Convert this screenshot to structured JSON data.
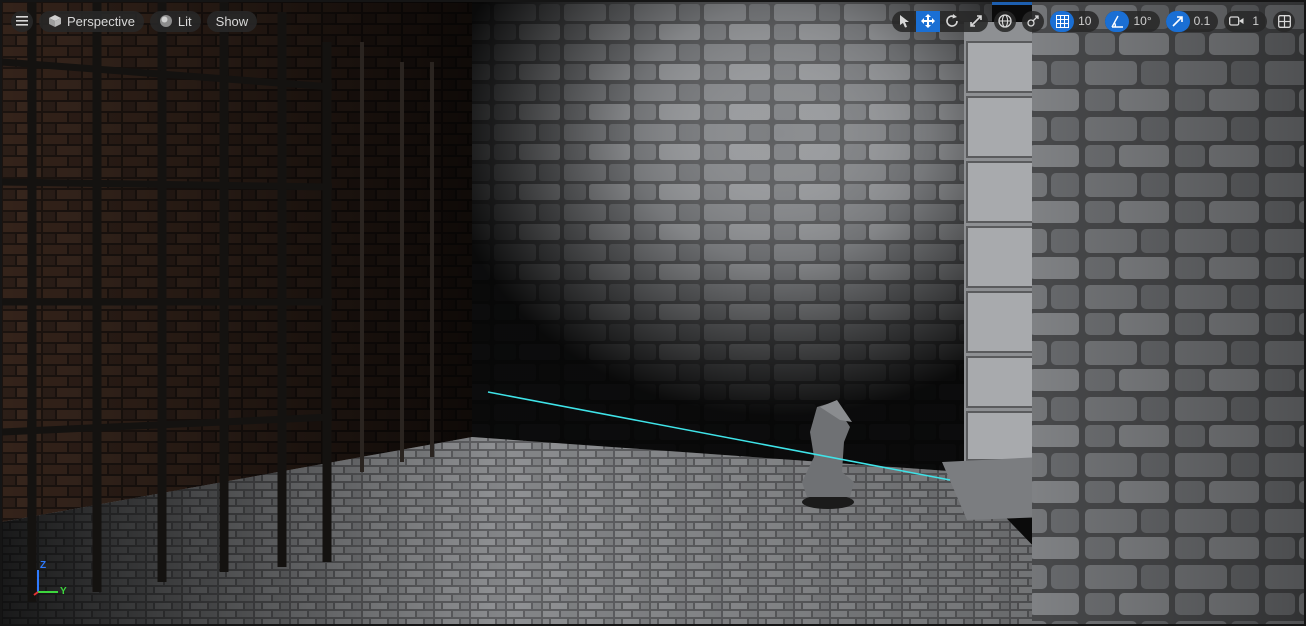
{
  "viewport": {
    "view_mode": "Perspective",
    "lighting_mode": "Lit",
    "show_label": "Show",
    "grid_snap_value": "10",
    "rotation_snap_value": "10°",
    "scale_snap_value": "0.1",
    "camera_speed": "1",
    "axis_labels": {
      "z": "Z",
      "y": "Y"
    }
  },
  "colors": {
    "accent": "#1a6fd4",
    "toolbar_bg": "#282828",
    "trace_line": "#3fe3e8"
  },
  "icons": {
    "menu": "hamburger-icon",
    "perspective": "cube-icon",
    "lit": "sphere-icon",
    "select": "pointer-icon",
    "translate": "move-arrows-icon",
    "rotate": "rotate-icon",
    "scale": "scale-icon",
    "world": "globe-icon",
    "surface_snap": "surface-snap-icon",
    "grid_snap": "grid-icon",
    "rotation_snap": "angle-icon",
    "scale_snap": "scale-arrow-icon",
    "camera_speed": "camera-icon",
    "layout": "viewport-layout-icon"
  }
}
